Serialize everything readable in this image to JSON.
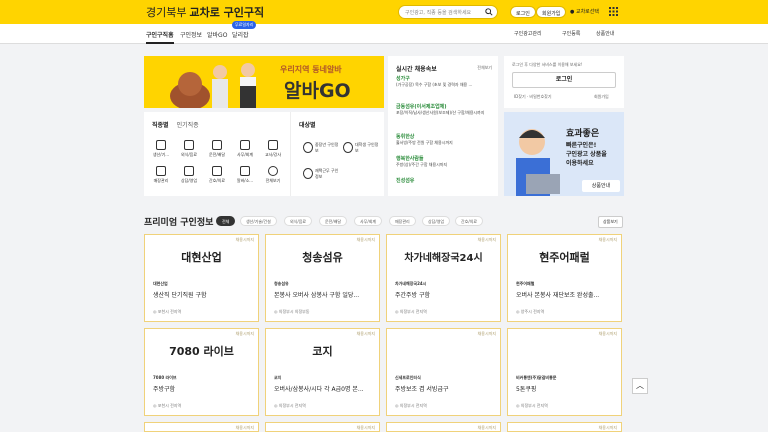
{
  "header": {
    "region": "경기북부",
    "title": "교차로 구인구직",
    "search_placeholder": "구인광고, 직종 등을 검색하세요",
    "login": "로그인",
    "signup": "회원가입",
    "location": "교차로선택"
  },
  "nav": {
    "items": [
      "구인구직홈",
      "구인정보",
      "알바GO",
      "달리잡"
    ],
    "new_badge": "무료일자리",
    "right": [
      "구인광고관리",
      "구인등록",
      "상품안내"
    ]
  },
  "banner": {
    "sub": "우리지역 동네알바",
    "main": "알바GO"
  },
  "categories": {
    "tabs": [
      "직종별",
      "인기직종"
    ],
    "items": [
      "생산/기...",
      "외식/음료",
      "운전/배달",
      "사무/회계",
      "교사/강사",
      "매장관리",
      "상담/영업",
      "간호/의료",
      "알바/소...",
      "전체보기"
    ]
  },
  "target": {
    "title": "대상별",
    "items": [
      "중장년 구인정보",
      "대학생 구인정보",
      "재택근무 구인정보"
    ]
  },
  "realtime": {
    "title": "실시간 채용속보",
    "all": "전체보기",
    "items": [
      {
        "company": "성가구",
        "desc": "(가구공장) 목수 구함 (초보 및 경력자 채용 ..."
      },
      {
        "company": "금동섬유(이서제조업체)",
        "desc": "포장/이직/납사/생산사원(보조제)/산 구함/채용시까지"
      },
      {
        "company": "동휘한상",
        "desc": "홀서빙/주방 전원 구함 채용시까지"
      },
      {
        "company": "행복한사람들",
        "desc": "주방(상)/주간 구함 채용시까지"
      },
      {
        "company": "진성섬유",
        "desc": ""
      }
    ]
  },
  "login_panel": {
    "message": "로그인 후 다양한 서비스를 이용해 보세요!",
    "button": "로그인",
    "find": "ID찾기 · 비밀번호찾기",
    "join": "회원가입"
  },
  "ad": {
    "lines": [
      "효과좋은",
      "빠른구인은!",
      "구인광고 상품을",
      "이용하세요"
    ],
    "button": "상품안내"
  },
  "premium": {
    "title": "프리미엄 구인정보",
    "filters": [
      "전체",
      "생산/기술/건설",
      "외식/음료",
      "운전/배달",
      "사무/회계",
      "매장관리",
      "상담/영업",
      "간호/의료"
    ],
    "more": "상품보기",
    "cards": [
      {
        "clip": "채용시까지",
        "logo": "대현산업",
        "company": "대현산업",
        "job": "생산직 단기직원 구함",
        "location": "포천시 전지역"
      },
      {
        "clip": "채용시까지",
        "logo": "청송섬유",
        "company": "청송섬유",
        "job": "본봉사 오버사 삼봉사 구함 일당...",
        "location": "의정부시 의정부동"
      },
      {
        "clip": "채용시까지",
        "logo": "차가네해장국24시",
        "company": "차가네해장국24시",
        "job": "주간주방 구함",
        "location": "의정부시 전지역"
      },
      {
        "clip": "채용시까지",
        "logo": "현주어패럴",
        "company": "현주어패럴",
        "job": "오버사 본봉사 재단보조 완성출...",
        "location": "양주시 전지역"
      },
      {
        "clip": "채용시까지",
        "logo": "7080 라이브",
        "company": "7080 라이브",
        "job": "주방구함",
        "location": "포천시 전지역"
      },
      {
        "clip": "채용시까지",
        "logo": "코지",
        "company": "코지",
        "job": "오버사/삼봉사/시다 각 A급0명 본...",
        "location": "의정부시 전지역"
      },
      {
        "clip": "채용시까지",
        "logo": "",
        "company": "신세프로인터식",
        "job": "주방보조 겸 서빙급구",
        "location": "의정부시 전지역"
      },
      {
        "clip": "채용시까지",
        "logo": "",
        "company": "비커롱앤(주)닭갈비롱문",
        "job": "5톤쿠핑",
        "location": "의정부시 전지역"
      },
      {
        "clip": "채용시까지"
      },
      {
        "clip": "채용시까지"
      },
      {
        "clip": "채용시까지"
      },
      {
        "clip": "채용시까지"
      }
    ]
  }
}
